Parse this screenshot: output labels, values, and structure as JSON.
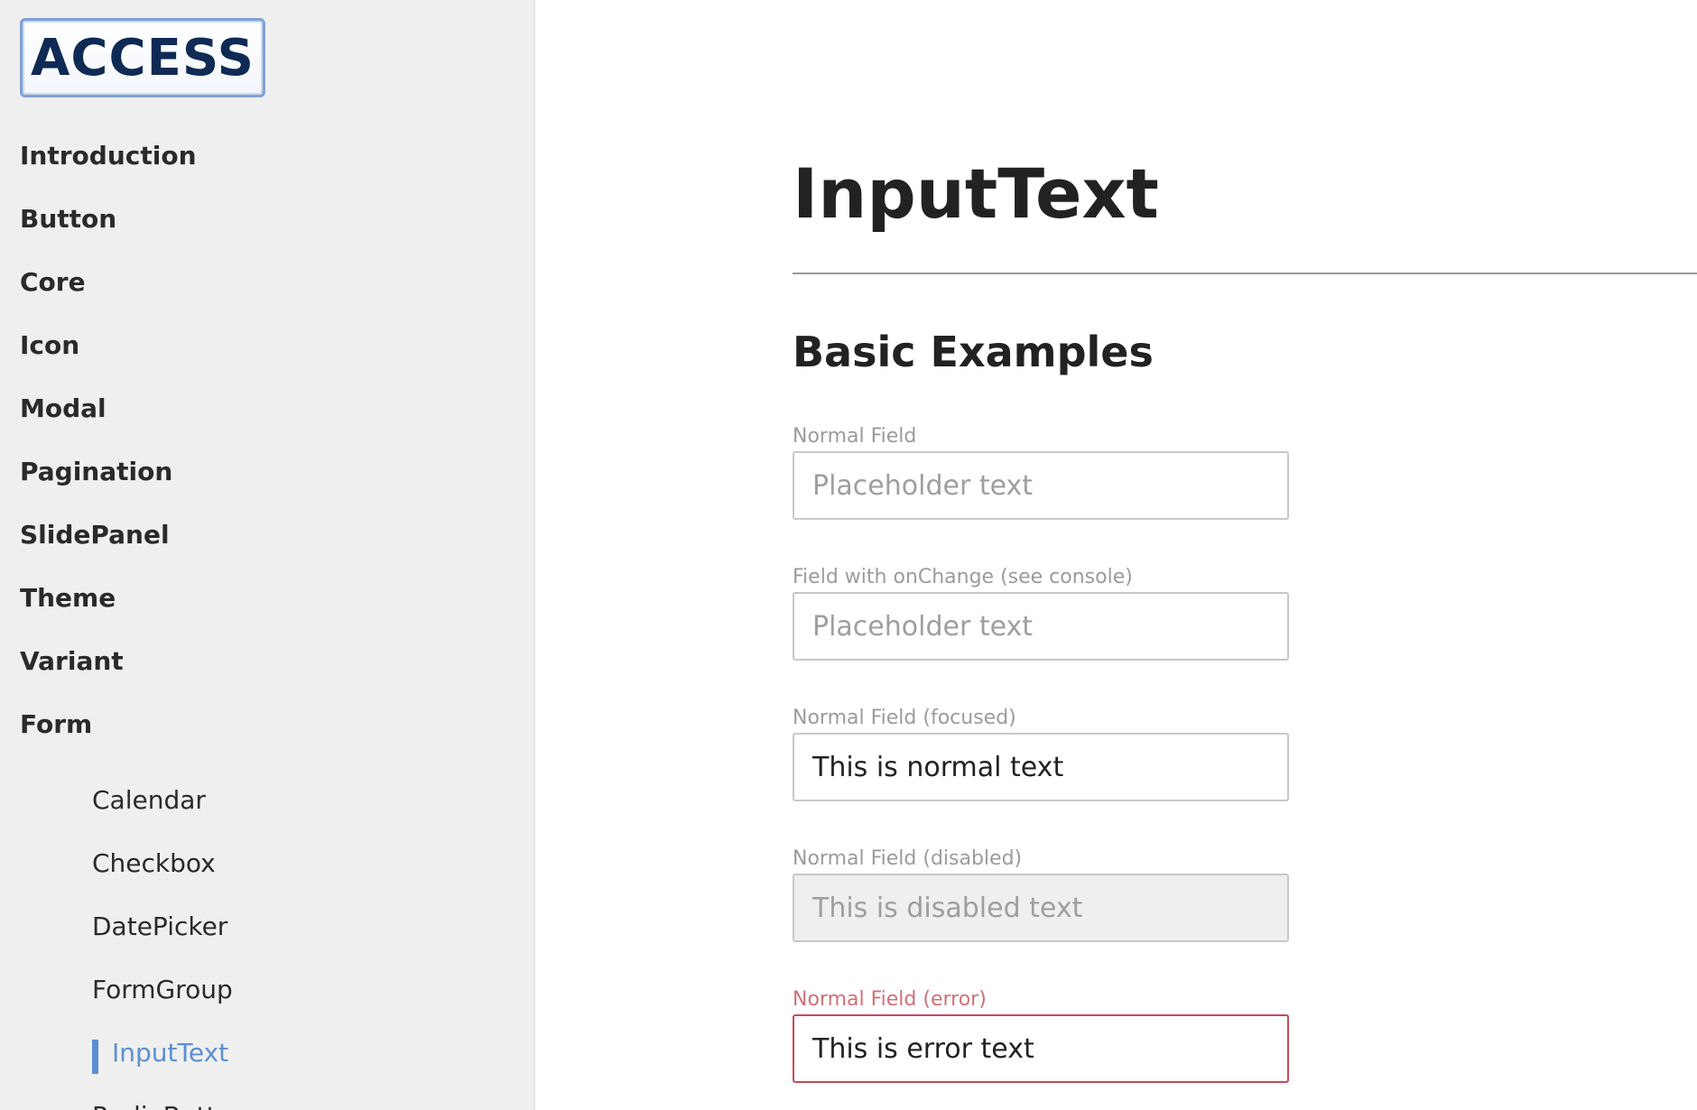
{
  "logo": {
    "text": "ACCESS"
  },
  "sidebar": {
    "items": [
      {
        "label": "Introduction"
      },
      {
        "label": "Button"
      },
      {
        "label": "Core"
      },
      {
        "label": "Icon"
      },
      {
        "label": "Modal"
      },
      {
        "label": "Pagination"
      },
      {
        "label": "SlidePanel"
      },
      {
        "label": "Theme"
      },
      {
        "label": "Variant"
      },
      {
        "label": "Form"
      }
    ],
    "form_sub_items": [
      {
        "label": "Calendar"
      },
      {
        "label": "Checkbox"
      },
      {
        "label": "DatePicker"
      },
      {
        "label": "FormGroup"
      },
      {
        "label": "InputText",
        "active": true
      },
      {
        "label": "RadioButton"
      }
    ]
  },
  "main": {
    "title": "InputText",
    "section_heading": "Basic Examples",
    "fields": [
      {
        "label": "Normal Field",
        "value": "",
        "placeholder": "Placeholder text",
        "state": "normal"
      },
      {
        "label": "Field with onChange (see console)",
        "value": "",
        "placeholder": "Placeholder text",
        "state": "normal"
      },
      {
        "label": "Normal Field (focused)",
        "value": "This is normal text",
        "placeholder": "",
        "state": "focused"
      },
      {
        "label": "Normal Field (disabled)",
        "value": "This is disabled text",
        "placeholder": "",
        "state": "disabled"
      },
      {
        "label": "Normal Field (error)",
        "value": "This is error text",
        "placeholder": "",
        "state": "error"
      }
    ]
  },
  "colors": {
    "accent": "#5b8fd2",
    "error": "#c94a5a",
    "sidebar_bg": "#efefef",
    "logo_text": "#0f2a55"
  }
}
